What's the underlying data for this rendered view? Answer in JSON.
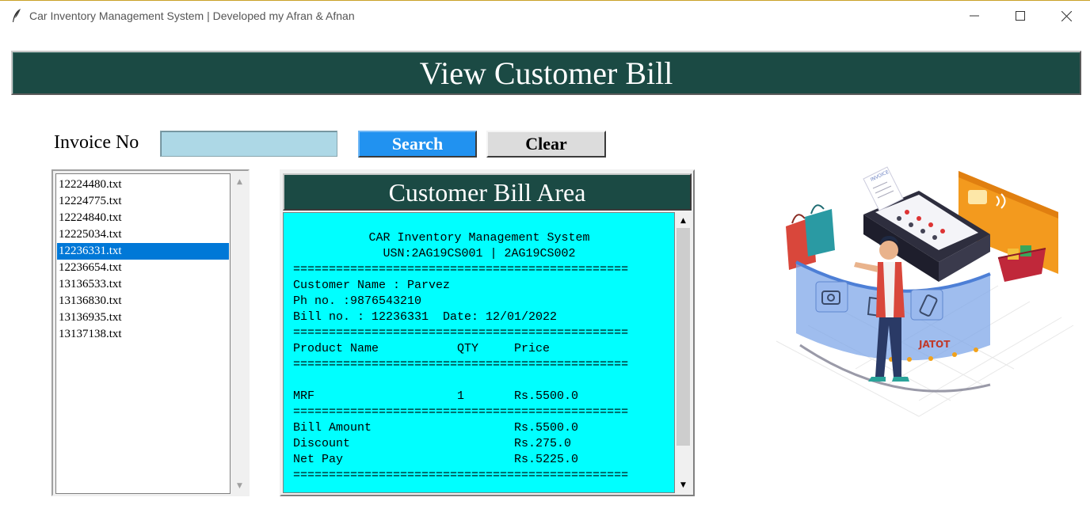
{
  "window": {
    "title": "Car Inventory Management System | Developed my Afran & Afnan",
    "controls": [
      "minimize",
      "maximize",
      "close"
    ]
  },
  "header": {
    "title": "View Customer Bill"
  },
  "search": {
    "label": "Invoice No",
    "value": "",
    "search_label": "Search",
    "clear_label": "Clear"
  },
  "files": {
    "items": [
      "12224480.txt",
      "12224775.txt",
      "12224840.txt",
      "12225034.txt",
      "12236331.txt",
      "12236654.txt",
      "13136533.txt",
      "13136830.txt",
      "13136935.txt",
      "13137138.txt"
    ],
    "selected": "12236331.txt"
  },
  "bill": {
    "title": "Customer Bill Area",
    "system_name": "CAR Inventory Management System",
    "usn_line": "USN:2AG19CS001 | 2AG19CS002",
    "separator": "===============================================",
    "customer_line": "Customer Name : Parvez",
    "phone_line": "Ph no. :9876543210",
    "bill_line": "Bill no. : 12236331  Date: 12/01/2022",
    "columns_line": "Product Name           QTY     Price",
    "item_line": "MRF                    1       Rs.5500.0",
    "bill_amount_line": "Bill Amount                    Rs.5500.0",
    "discount_line": "Discount                       Rs.275.0",
    "net_pay_line": "Net Pay                        Rs.5225.0"
  },
  "illustration": {
    "screen_text": "JATOT",
    "paper_text": "INVOICE"
  },
  "colors": {
    "header_bg": "#1b4a44",
    "search_button": "#2192f0",
    "input_bg": "#add8e6",
    "bill_bg": "#00ffff",
    "selection": "#0078d7"
  }
}
